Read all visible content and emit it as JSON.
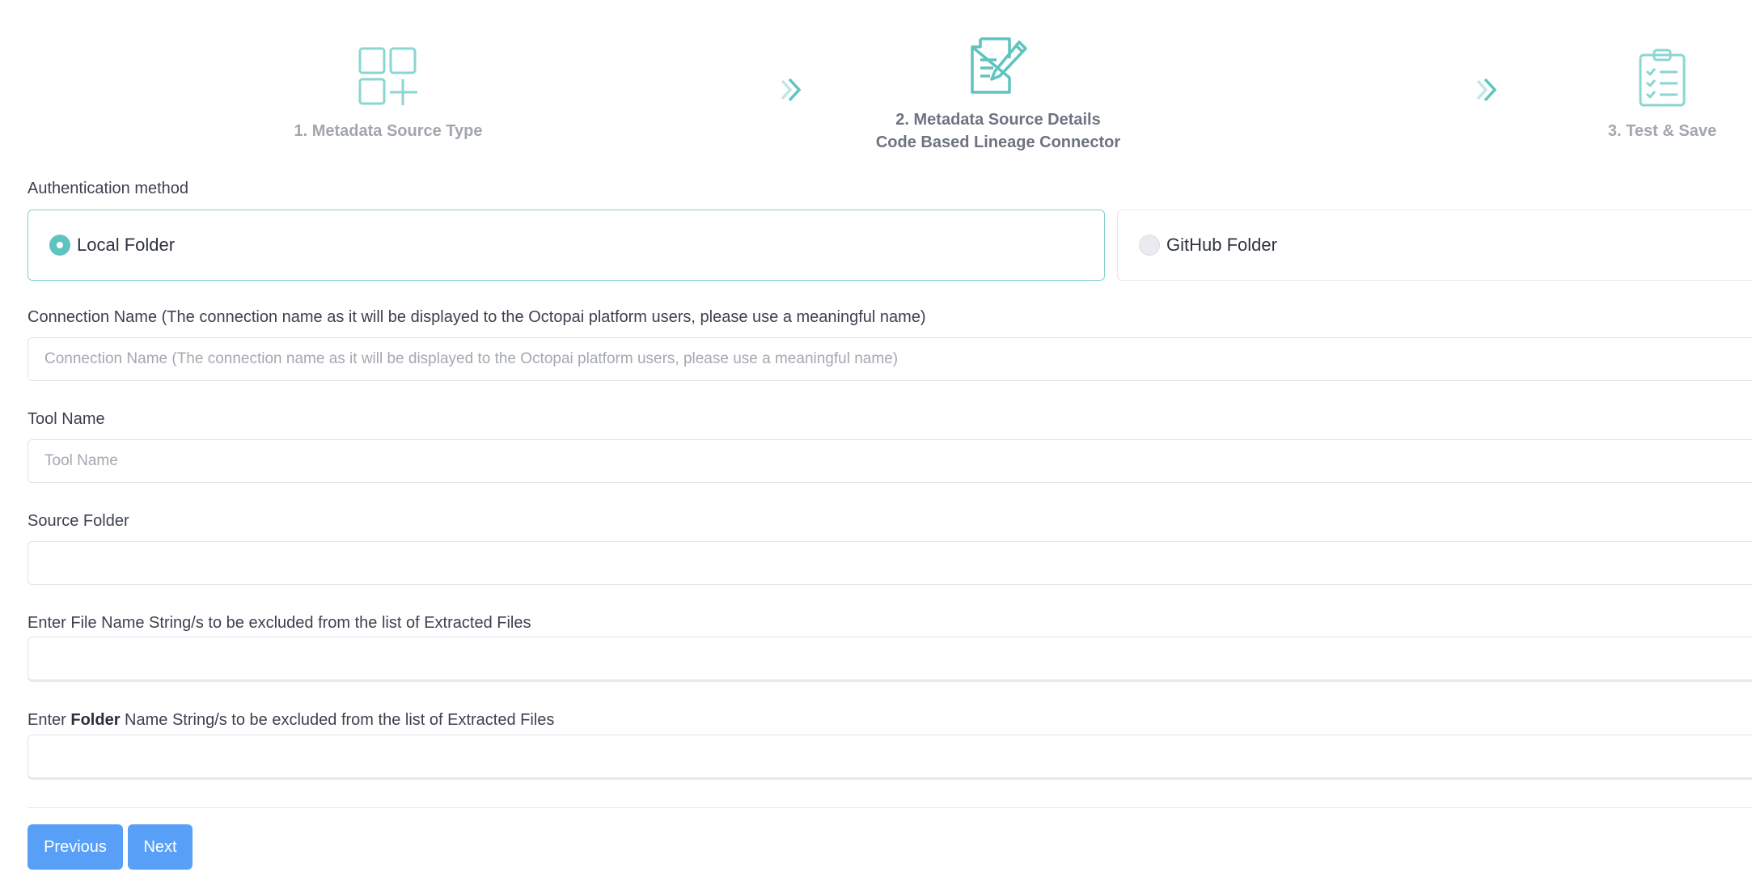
{
  "stepper": {
    "steps": [
      {
        "label": "1. Metadata Source Type",
        "icon": "grid-plus-icon"
      },
      {
        "label": "2. Metadata Source Details",
        "sublabel": "Code Based Lineage Connector",
        "icon": "document-pencil-icon"
      },
      {
        "label": "3. Test & Save",
        "icon": "clipboard-checklist-icon"
      }
    ],
    "separator_icon": "double-chevron-right-icon"
  },
  "colors": {
    "accent": "#5ec4bf",
    "button": "#58a0f7",
    "step_inactive": "#a2a6ad",
    "step_active": "#6d7380"
  },
  "auth": {
    "label": "Authentication method",
    "options": [
      {
        "label": "Local Folder",
        "selected": true
      },
      {
        "label": "GitHub Folder",
        "selected": false
      }
    ]
  },
  "fields": {
    "connection_name": {
      "label": "Connection Name (The connection name as it will be displayed to the Octopai platform users, please use a meaningful name)",
      "placeholder": "Connection Name (The connection name as it will be displayed to the Octopai platform users, please use a meaningful name)",
      "value": ""
    },
    "tool_name": {
      "label": "Tool Name",
      "placeholder": "Tool Name",
      "value": ""
    },
    "source_folder": {
      "label": "Source Folder",
      "value": ""
    },
    "exclude_files": {
      "label": "Enter File Name String/s to be excluded from the list of Extracted Files",
      "value": ""
    },
    "exclude_folders": {
      "label_prefix": "Enter ",
      "label_bold": "Folder",
      "label_suffix": " Name String/s to be excluded from the list of Extracted Files",
      "value": ""
    }
  },
  "buttons": {
    "previous": "Previous",
    "next": "Next"
  }
}
